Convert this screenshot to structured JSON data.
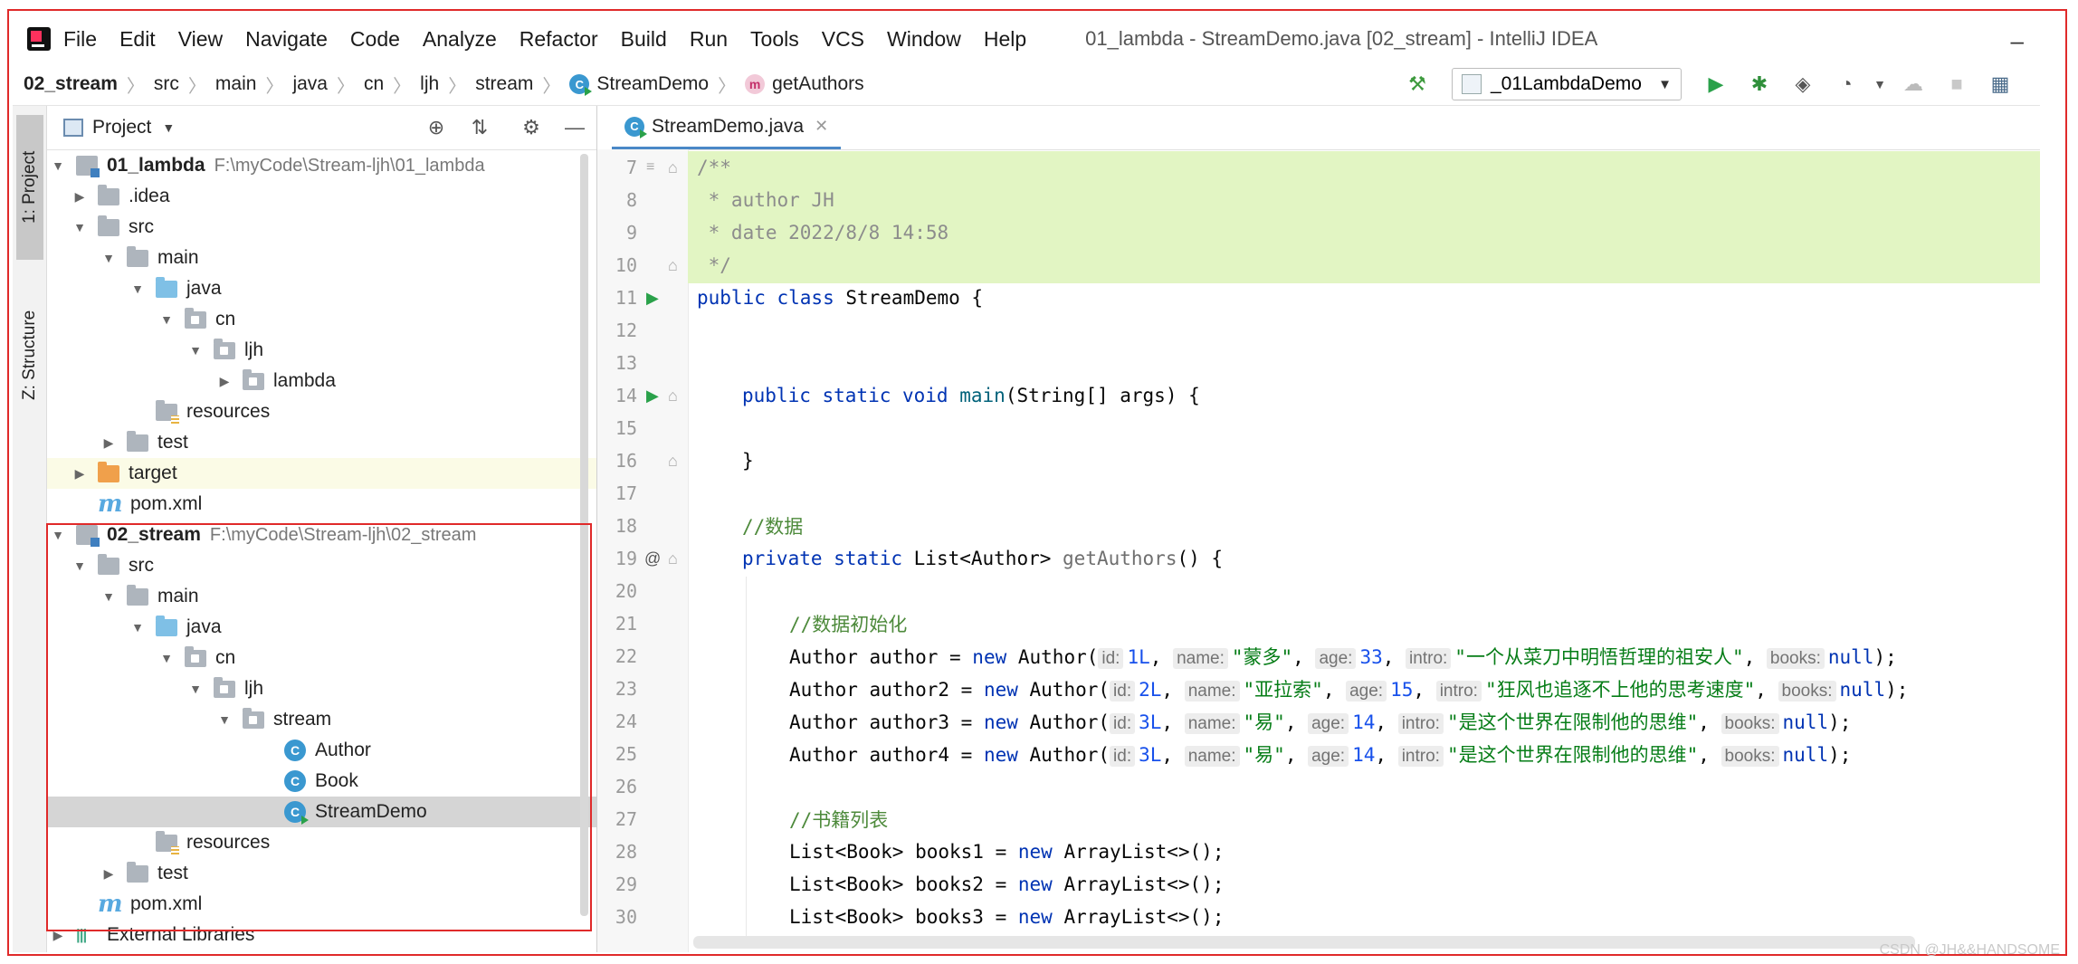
{
  "menu": {
    "items": [
      "File",
      "Edit",
      "View",
      "Navigate",
      "Code",
      "Analyze",
      "Refactor",
      "Build",
      "Run",
      "Tools",
      "VCS",
      "Window",
      "Help"
    ],
    "window_title": "01_lambda - StreamDemo.java [02_stream] - IntelliJ IDEA",
    "minimize_glyph": "–"
  },
  "breadcrumb": [
    "02_stream",
    "src",
    "main",
    "java",
    "cn",
    "ljh",
    "stream",
    "StreamDemo",
    "getAuthors"
  ],
  "run_config": "_01LambdaDemo",
  "tool_strip": {
    "project_tab": "1: Project",
    "structure_tab": "Z: Structure"
  },
  "project_panel": {
    "title": "Project"
  },
  "tree": [
    {
      "name": "01_lambda",
      "path": "F:\\myCode\\Stream-ljh\\01_lambda"
    },
    {
      "name": ".idea"
    },
    {
      "name": "src"
    },
    {
      "name": "main"
    },
    {
      "name": "java"
    },
    {
      "name": "cn"
    },
    {
      "name": "ljh"
    },
    {
      "name": "lambda"
    },
    {
      "name": "resources"
    },
    {
      "name": "test"
    },
    {
      "name": "target"
    },
    {
      "name": "pom.xml"
    },
    {
      "name": "02_stream",
      "path": "F:\\myCode\\Stream-ljh\\02_stream"
    },
    {
      "name": "src"
    },
    {
      "name": "main"
    },
    {
      "name": "java"
    },
    {
      "name": "cn"
    },
    {
      "name": "ljh"
    },
    {
      "name": "stream"
    },
    {
      "name": "Author"
    },
    {
      "name": "Book"
    },
    {
      "name": "StreamDemo"
    },
    {
      "name": "resources"
    },
    {
      "name": "test"
    },
    {
      "name": "pom.xml"
    },
    {
      "name": "External Libraries"
    }
  ],
  "editor": {
    "tab_label": "StreamDemo.java",
    "line_numbers": [
      "7",
      "8",
      "9",
      "10",
      "11",
      "12",
      "13",
      "14",
      "15",
      "16",
      "17",
      "18",
      "19",
      "20",
      "21",
      "22",
      "23",
      "24",
      "25",
      "26",
      "27",
      "28",
      "29",
      "30"
    ],
    "doc_open": "/**",
    "doc_author": " * author JH",
    "doc_date": " * date 2022/8/8 14:58",
    "doc_close": " */",
    "line11": {
      "k1": "public class",
      "rest": " StreamDemo {"
    },
    "line14": {
      "k1": "public static void",
      "m": "main",
      "rest": "(String[] args) {"
    },
    "line16": "}",
    "line18": "//数据",
    "line19": {
      "k1": "private static",
      "t": " List<Author> ",
      "m": "getAuthors",
      "rest": "() {"
    },
    "line21": "//数据初始化",
    "authors": [
      {
        "lhs": "Author author = ",
        "id": "1L",
        "name": "\"蒙多\"",
        "age": "33",
        "intro": "\"一个从菜刀中明悟哲理的祖安人\"",
        "end": ");"
      },
      {
        "lhs": "Author author2 = ",
        "id": "2L",
        "name": "\"亚拉索\"",
        "age": "15",
        "intro": "\"狂风也追逐不上他的思考速度\"",
        "end": ");"
      },
      {
        "lhs": "Author author3 = ",
        "id": "3L",
        "name": "\"易\"",
        "age": "14",
        "intro": "\"是这个世界在限制他的思维\"",
        "end": ");"
      },
      {
        "lhs": "Author author4 = ",
        "id": "3L",
        "name": "\"易\"",
        "age": "14",
        "intro": "\"是这个世界在限制他的思维\"",
        "end": ");"
      }
    ],
    "hints": {
      "id": "id:",
      "name": "name:",
      "age": "age:",
      "intro": "intro:",
      "books": "books:"
    },
    "kw_new": "new",
    "ctor": " Author(",
    "null": "null",
    "line27": "//书籍列表",
    "books": [
      {
        "lhs": "List<Book> books1 = ",
        "rhs": " ArrayList<>();"
      },
      {
        "lhs": "List<Book> books2 = ",
        "rhs": " ArrayList<>();"
      },
      {
        "lhs": "List<Book> books3 = ",
        "rhs": " ArrayList<>();"
      }
    ]
  },
  "watermark": "CSDN @JH&&HANDSOME"
}
